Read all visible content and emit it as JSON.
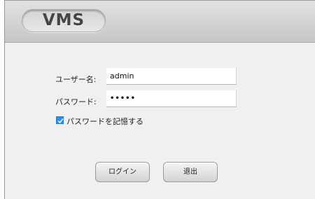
{
  "header": {
    "logo_text": "VMS"
  },
  "login_form": {
    "username_label": "ユーザー名:",
    "username_value": "admin",
    "password_label": "パスワード:",
    "password_value": "•••••",
    "remember_label": "パスワードを記憶する",
    "remember_checked": true
  },
  "buttons": {
    "login_label": "ログイン",
    "exit_label": "退出"
  },
  "colors": {
    "accent": "#2f8fe6",
    "header_bg": "#d0d0d0",
    "body_bg": "#f0f0f0"
  }
}
